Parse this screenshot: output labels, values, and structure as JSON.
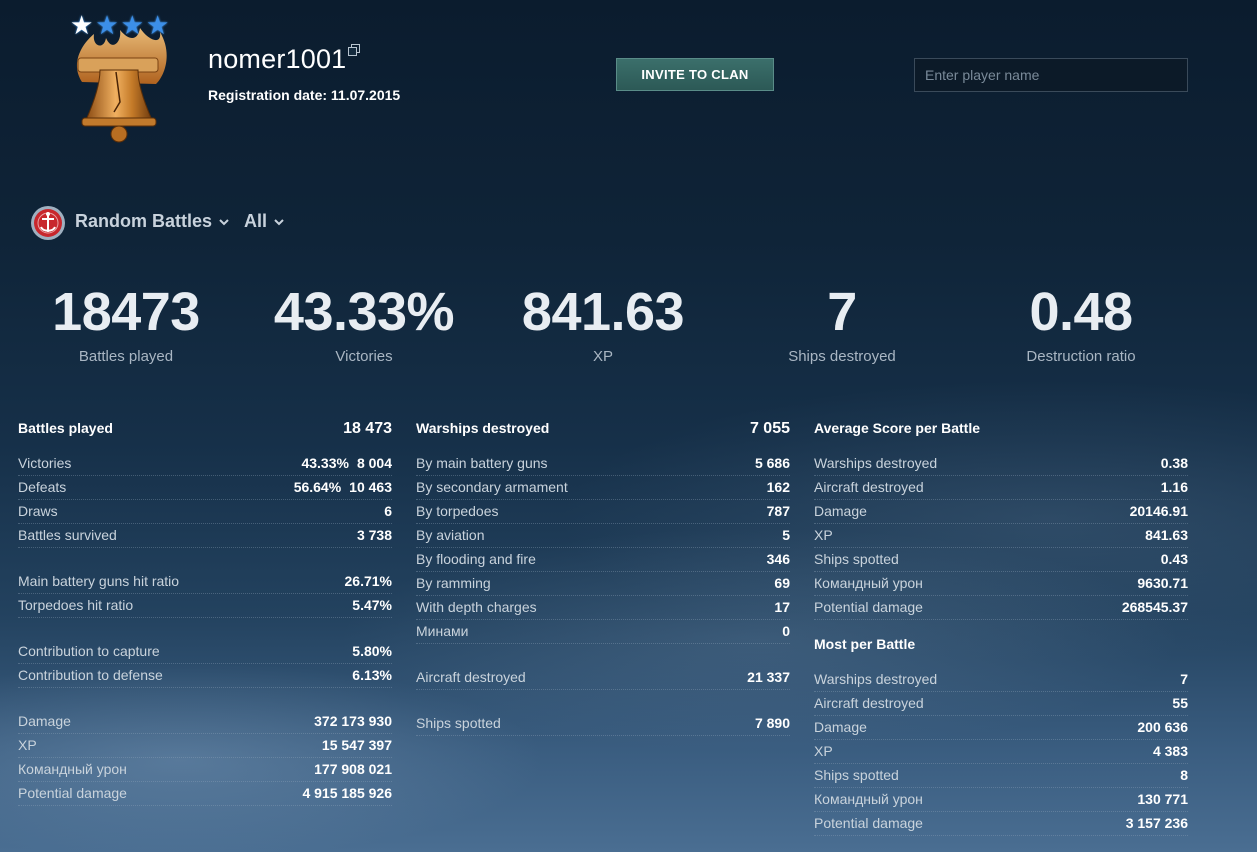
{
  "player": {
    "name": "nomer1001",
    "registration": "Registration date: 11.07.2015"
  },
  "header": {
    "invite_label": "INVITE TO CLAN",
    "search_placeholder": "Enter player name"
  },
  "filters": {
    "mode": "Random Battles",
    "type": "All"
  },
  "big_stats": [
    {
      "value": "18473",
      "label": "Battles played"
    },
    {
      "value": "43.33%",
      "label": "Victories"
    },
    {
      "value": "841.63",
      "label": "XP"
    },
    {
      "value": "7",
      "label": "Ships destroyed"
    },
    {
      "value": "0.48",
      "label": "Destruction ratio"
    }
  ],
  "col1": {
    "title": "Battles played",
    "total": "18 473",
    "rows": [
      {
        "label": "Victories",
        "pct": "43.33%",
        "value": "8 004"
      },
      {
        "label": "Defeats",
        "pct": "56.64%",
        "value": "10 463"
      },
      {
        "label": "Draws",
        "value": "6"
      },
      {
        "label": "Battles survived",
        "value": "3 738"
      }
    ],
    "hit_rows": [
      {
        "label": "Main battery guns hit ratio",
        "value": "26.71%"
      },
      {
        "label": "Torpedoes hit ratio",
        "value": "5.47%"
      }
    ],
    "contrib_rows": [
      {
        "label": "Contribution to capture",
        "value": "5.80%"
      },
      {
        "label": "Contribution to defense",
        "value": "6.13%"
      }
    ],
    "totals_rows": [
      {
        "label": "Damage",
        "value": "372 173 930"
      },
      {
        "label": "XP",
        "value": "15 547 397"
      },
      {
        "label": "Командный урон",
        "value": "177 908 021"
      },
      {
        "label": "Potential damage",
        "value": "4 915 185 926"
      }
    ]
  },
  "col2": {
    "title": "Warships destroyed",
    "total": "7 055",
    "rows": [
      {
        "label": "By main battery guns",
        "value": "5 686"
      },
      {
        "label": "By secondary armament",
        "value": "162"
      },
      {
        "label": "By torpedoes",
        "value": "787"
      },
      {
        "label": "By aviation",
        "value": "5"
      },
      {
        "label": "By flooding and fire",
        "value": "346"
      },
      {
        "label": "By ramming",
        "value": "69"
      },
      {
        "label": "With depth charges",
        "value": "17"
      },
      {
        "label": "Минами",
        "value": "0"
      }
    ],
    "aircraft": {
      "label": "Aircraft destroyed",
      "value": "21 337"
    },
    "spotted": {
      "label": "Ships spotted",
      "value": "7 890"
    }
  },
  "col3": {
    "avg_title": "Average Score per Battle",
    "avg_rows": [
      {
        "label": "Warships destroyed",
        "value": "0.38"
      },
      {
        "label": "Aircraft destroyed",
        "value": "1.16"
      },
      {
        "label": "Damage",
        "value": "20146.91"
      },
      {
        "label": "XP",
        "value": "841.63"
      },
      {
        "label": "Ships spotted",
        "value": "0.43"
      },
      {
        "label": "Командный урон",
        "value": "9630.71"
      },
      {
        "label": "Potential damage",
        "value": "268545.37"
      }
    ],
    "most_title": "Most per Battle",
    "most_rows": [
      {
        "label": "Warships destroyed",
        "value": "7"
      },
      {
        "label": "Aircraft destroyed",
        "value": "55"
      },
      {
        "label": "Damage",
        "value": "200 636"
      },
      {
        "label": "XP",
        "value": "4 383"
      },
      {
        "label": "Ships spotted",
        "value": "8"
      },
      {
        "label": "Командный урон",
        "value": "130 771"
      },
      {
        "label": "Potential damage",
        "value": "3 157 236"
      }
    ]
  }
}
